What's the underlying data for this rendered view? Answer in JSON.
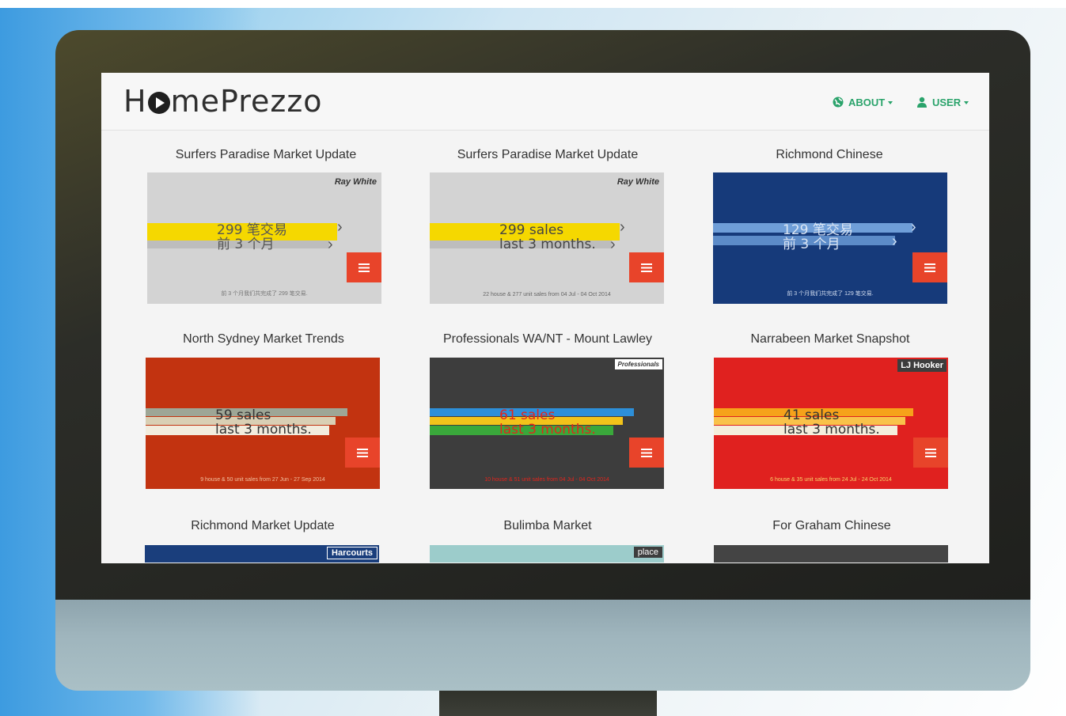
{
  "app": {
    "logo": "HomePrezzo"
  },
  "nav": {
    "about": "ABOUT",
    "user": "USER"
  },
  "cards": [
    {
      "title": "Surfers Paradise Market Update",
      "brand": "Ray White",
      "line1": "299 笔交易",
      "line2": "前 3 个月",
      "footer": "前 3 个月我们共完成了 299 笔交易.",
      "bg": "#d5d5d5",
      "stripe": "#f5d800"
    },
    {
      "title": "Surfers Paradise Market Update",
      "brand": "Ray White",
      "line1": "299 sales",
      "line2": "last 3 months.",
      "footer": "22 house & 277 unit sales from 04 Jul - 04 Oct 2014",
      "bg": "#d5d5d5",
      "stripe": "#f5d800"
    },
    {
      "title": "Richmond Chinese",
      "line1": "129 笔交易",
      "line2": "前 3 个月",
      "footer": "前 3 个月我们共完成了 129 笔交易.",
      "bg": "#163a7a",
      "stripe": "#6f9ed8"
    },
    {
      "title": "North Sydney Market Trends",
      "line1": "59 sales",
      "line2": "last 3 months.",
      "footer": "9 house & 50 unit sales from 27 Jun - 27 Sep 2014",
      "bg": "#c23310",
      "stripe": "#cfc8b0"
    },
    {
      "title": "Professionals WA/NT - Mount Lawley",
      "brand": "Professionals",
      "line1": "61 sales",
      "line2": "last 3 months.",
      "footer": "10 house & 51 unit sales from 04 Jul - 04 Oct 2014",
      "bg": "#3d3d3d",
      "stripe": "#2d8fd8"
    },
    {
      "title": "Narrabeen Market Snapshot",
      "brand": "LJ Hooker",
      "line1": "41 sales",
      "line2": "last 3 months.",
      "footer": "6 house & 35 unit sales from 24 Jul - 24 Oct 2014",
      "bg": "#e0211f",
      "stripe": "#f6a21a"
    },
    {
      "title": "Richmond Market Update",
      "brand": "Harcourts",
      "bg": "#1a3e7c"
    },
    {
      "title": "Bulimba Market",
      "brand": "place",
      "bg": "#9ccccb"
    },
    {
      "title": "For Graham Chinese",
      "bg": "#444444"
    }
  ]
}
